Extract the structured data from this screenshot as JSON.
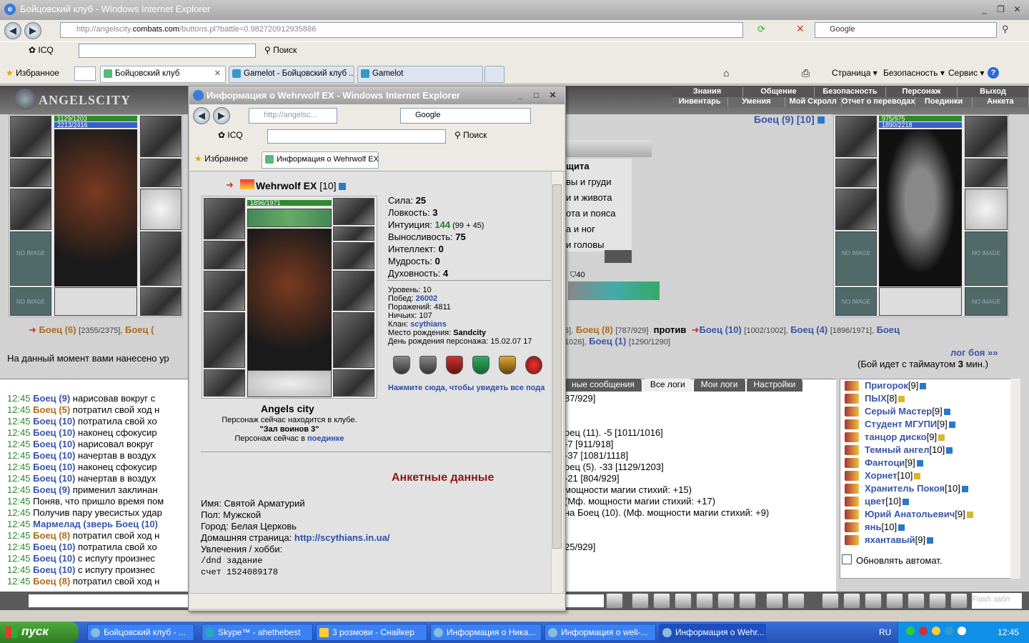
{
  "main_window": {
    "title": "Бойцовский клуб - Windows Internet Explorer",
    "address_prefix": "http://angelscity.",
    "address_host": "combats.com",
    "address_suffix": "/buttons.pl?battle=0.982720912935886",
    "search_engine": "Google",
    "toolbar": {
      "icq": "ICQ",
      "search": "Поиск"
    },
    "tabs": [
      {
        "label": "Избранное"
      },
      {
        "label": "Бойцовский клуб"
      },
      {
        "label": "Gamelot - Бойцовский клуб ..."
      },
      {
        "label": "Gamelot"
      }
    ],
    "right_menu": {
      "page": "Страница",
      "security": "Безопасность",
      "service": "Сервис"
    }
  },
  "game": {
    "logo": "ANGELSCITY",
    "menu_top": [
      "Знания",
      "Общение",
      "Безопасность",
      "Персонаж",
      "Выход"
    ],
    "menu_bottom": [
      "Инвентарь",
      "Умения",
      "Мой Скролл",
      "Отчет о переводах",
      "Поединки",
      "Анкета"
    ],
    "left_hp": "1129/1203",
    "left_mp": "2213/2416",
    "right_hp": "975/975",
    "right_mp": "1890/2218",
    "no_image": "NO IMAGE",
    "opponent_header": "Боец (9) [10]",
    "combat_left": {
      "name1": "Боец (6)",
      "hp1": "[2355/2375],",
      "name2": "Боец ("
    },
    "combat_right": {
      "pre": "6],",
      "name1": "Боец (8)",
      "hp1": "[787/929]",
      "vs": "против",
      "name2": "Боец (10)",
      "hp2": "[1002/1002],",
      "name3": "Боец (4)",
      "hp3": "[1896/1971],",
      "name4": "Боец",
      "line2_pre": "1026],",
      "name5": "Боец (1)",
      "hp5": "[1290/1290]"
    },
    "damage_text": "На данный момент вами нанесено ур",
    "battle_log_link": "лог боя »»",
    "timeout_text": "(Бой идет с таймаутом",
    "timeout_value": "3",
    "timeout_unit": "мин.)",
    "defense": [
      "щита",
      "вы и груди",
      "и и живота",
      "ота и пояса",
      "а и ног",
      "и головы"
    ],
    "slot_count": "40",
    "log_tabs": [
      "ные сообщения",
      "Все логи",
      "Мои логи",
      "Настройки"
    ],
    "log_lines": [
      {
        "time": "12:45",
        "who": "Боец (9)",
        "cls": "blue",
        "text": " нарисовав вокруг с"
      },
      {
        "time": "12:45",
        "who": "Боец (5)",
        "cls": "gold",
        "text": " потратил свой ход н"
      },
      {
        "time": "12:45",
        "who": "Боец (10)",
        "cls": "blue",
        "text": " потратила свой хо"
      },
      {
        "time": "12:45",
        "who": "Боец (10)",
        "cls": "blue",
        "text": " наконец сфокусир"
      },
      {
        "time": "12:45",
        "who": "Боец (10)",
        "cls": "blue",
        "text": " нарисовал вокруг"
      },
      {
        "time": "12:45",
        "who": "Боец (10)",
        "cls": "blue",
        "text": " начертав в воздух"
      },
      {
        "time": "12:45",
        "who": "Боец (10)",
        "cls": "blue",
        "text": " наконец сфокусир"
      },
      {
        "time": "12:45",
        "who": "Боец (10)",
        "cls": "blue",
        "text": " начертав в воздух"
      },
      {
        "time": "12:45",
        "who": "Боец (9)",
        "cls": "blue",
        "text": " применил заклинан"
      },
      {
        "time": "12:45",
        "who": "",
        "cls": "",
        "text": "Поняв, что пришло время пом"
      },
      {
        "time": "12:45",
        "who": "",
        "cls": "",
        "text": "Получив пару увесистых удар"
      },
      {
        "time": "12:45",
        "who": "Мармелад (зверь Боец (10)",
        "cls": "blue",
        "text": ""
      },
      {
        "time": "12:45",
        "who": "Боец (8)",
        "cls": "gold",
        "text": " потратил свой ход н"
      },
      {
        "time": "12:45",
        "who": "Боец (10)",
        "cls": "blue",
        "text": " потратила свой хо"
      },
      {
        "time": "12:45",
        "who": "Боец (10)",
        "cls": "blue",
        "text": " с испугу произнес"
      },
      {
        "time": "12:45",
        "who": "Боец (10)",
        "cls": "blue",
        "text": " с испугу произнес"
      },
      {
        "time": "12:45",
        "who": "Боец (8)",
        "cls": "gold",
        "text": " потратил свой ход н"
      }
    ],
    "log_right_lines": [
      "87/929]",
      "",
      "",
      "оец (11). -5 [1011/1016]",
      "-7 [911/918]",
      "-37 [1081/1118]",
      "оец (5). -33 [1129/1203]",
      "-21 [804/929]",
      "мощности магии стихий: +15)",
      "(Мф. мощности магии стихий: +17)",
      "на Боец (10). (Мф. мощности магии стихий: +9)",
      "",
      "",
      "25/929]"
    ],
    "players": [
      {
        "name": "Пригорок",
        "lvl": "[9]"
      },
      {
        "name": "ПЫХ",
        "lvl": "[8]"
      },
      {
        "name": "Серый Мастер",
        "lvl": "[9]"
      },
      {
        "name": "Студент МГУПИ",
        "lvl": "[9]"
      },
      {
        "name": "танцор диско",
        "lvl": "[9]"
      },
      {
        "name": "Темный ангел",
        "lvl": "[10]"
      },
      {
        "name": "Фантоци",
        "lvl": "[9]"
      },
      {
        "name": "Хорнет",
        "lvl": "[10]"
      },
      {
        "name": "Хранитель Покоя",
        "lvl": "[10]"
      },
      {
        "name": "цвет",
        "lvl": "[10]"
      },
      {
        "name": "Юрий Анатольевич",
        "lvl": "[9]"
      },
      {
        "name": "янь",
        "lvl": "[10]"
      },
      {
        "name": "яхантавый",
        "lvl": "[9]"
      }
    ],
    "auto_refresh": "Обновлять автомат.",
    "flash_text": "Flash забл"
  },
  "popup": {
    "title": "Информация о Wehrwolf EX - Windows Internet Explorer",
    "address": "http://angelsc...",
    "search_engine": "Google",
    "icq": "ICQ",
    "search": "Поиск",
    "favorites": "Избранное",
    "tab": "Информация о Wehrwolf EX",
    "char_name": "Wehrwolf EX",
    "char_level": "[10]",
    "hp": "1896/1971",
    "stats": [
      {
        "label": "Сила:",
        "value": "25",
        "extra": ""
      },
      {
        "label": "Ловкость:",
        "value": "3",
        "extra": ""
      },
      {
        "label": "Интуиция:",
        "value": "144",
        "extra": " (99 + 45)"
      },
      {
        "label": "Выносливость:",
        "value": "75",
        "extra": ""
      },
      {
        "label": "Интеллект:",
        "value": "0",
        "extra": ""
      },
      {
        "label": "Мудрость:",
        "value": "0",
        "extra": ""
      },
      {
        "label": "Духовность:",
        "value": "4",
        "extra": ""
      }
    ],
    "level_label": "Уровень:",
    "level_value": "10",
    "wins_label": "Побед:",
    "wins_value": "26002",
    "losses_label": "Поражений:",
    "losses_value": "4811",
    "draws_label": "Ничьих:",
    "draws_value": "107",
    "clan_label": "Клан:",
    "clan_value": "scythians",
    "birthplace_label": "Место рождения:",
    "birthplace_value": "Sandcity",
    "birthday_label": "День рождения персонажа:",
    "birthday_value": "15.02.07 17",
    "show_all": "Нажмите сюда, чтобы увидеть все пода",
    "city": "Angels city",
    "club_line1": "Персонаж сейчас находится в клубе.",
    "club_line2": "\"Зал воинов 3\"",
    "club_line3": "Персонаж сейчас в",
    "club_link": "поединке",
    "anketa_title": "Анкетные данные",
    "anketa": {
      "name": "Имя: Святой Арматурий",
      "gender": "Пол: Мужской",
      "city": "Город: Белая Церковь",
      "homepage_label": "Домашняя страница:",
      "homepage_url": "http://scythians.in.ua/",
      "hobby": "Увлечения / хобби:",
      "line1": "/dnd задание",
      "line2": "счет 1524089178"
    }
  },
  "taskbar": {
    "start": "пуск",
    "tasks": [
      "Бойцовский клуб - ...",
      "Skype™ - ahethebest",
      "3 розмови - Снайкер",
      "Информация о Ника...",
      "Информация о well-...",
      "Информация о Wehr..."
    ],
    "lang": "RU",
    "clock": "12:45"
  }
}
